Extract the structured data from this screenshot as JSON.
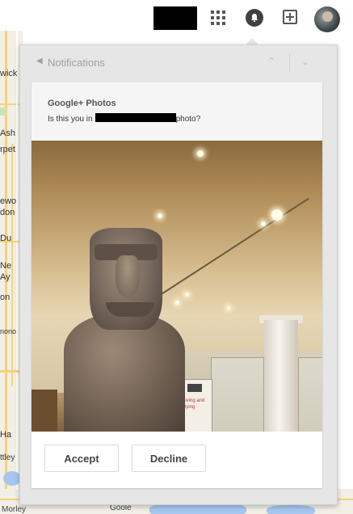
{
  "topbar": {
    "apps_icon": "apps-grid-icon",
    "notifications_icon": "bell-icon",
    "share_icon": "add-box-icon"
  },
  "map": {
    "left_labels": [
      "wick",
      "Ash",
      "rpet",
      "ewo",
      "don",
      "Du",
      "Ne",
      "Ay",
      "on",
      "nono",
      "Ha",
      "ttley",
      "Morley"
    ],
    "bottom_label": "Goole"
  },
  "panel": {
    "title": "Notifications",
    "back_icon": "triangle-left-icon",
    "nav_up_icon": "chevron-up-icon",
    "nav_down_icon": "chevron-down-icon"
  },
  "notification": {
    "source": "Google+ Photos",
    "message_prefix": "Is this you in",
    "message_suffix": "photo?",
    "photo_sign": "Living and Dying",
    "accept_label": "Accept",
    "decline_label": "Decline"
  }
}
